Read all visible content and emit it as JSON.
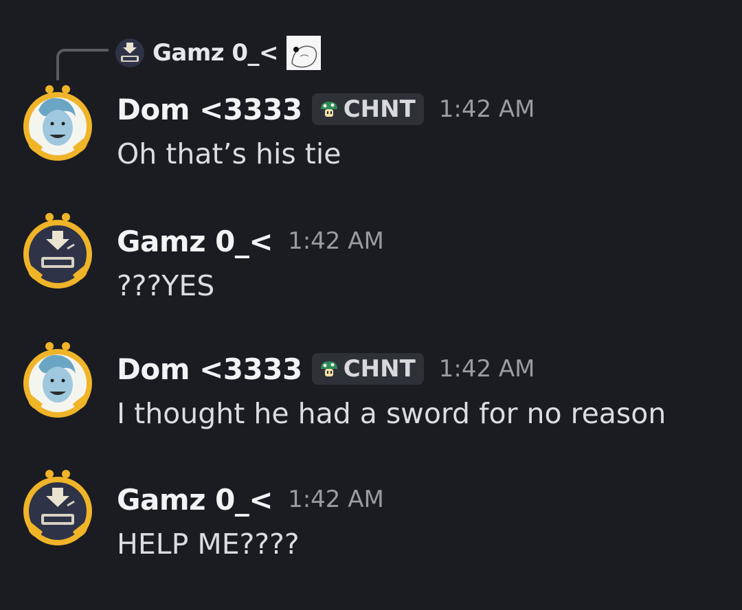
{
  "colors": {
    "background": "#1b1c21",
    "author": "#f2f3f5",
    "message_text": "#dcdde0",
    "timestamp": "#9a9ca3",
    "tag_background": "#2f3138",
    "avatar_ring": "#f0b429"
  },
  "reply": {
    "author": "Gamz 0_<",
    "avatar_icon": "gamz-avatar-icon",
    "attachment_icon": "image-thumbnail-icon"
  },
  "messages": [
    {
      "author": "Dom <3333",
      "tag": "CHNT",
      "tag_icon": "mushroom-icon",
      "time": "1:42 AM",
      "text": "Oh that’s his tie",
      "avatar_icon": "dom-avatar-icon"
    },
    {
      "author": "Gamz 0_<",
      "time": "1:42 AM",
      "text": "???YES",
      "avatar_icon": "gamz-avatar-icon"
    },
    {
      "author": "Dom <3333",
      "tag": "CHNT",
      "tag_icon": "mushroom-icon",
      "time": "1:42 AM",
      "text": "I thought he had a sword for no reason",
      "avatar_icon": "dom-avatar-icon"
    },
    {
      "author": "Gamz 0_<",
      "time": "1:42 AM",
      "text": "HELP ME????",
      "avatar_icon": "gamz-avatar-icon"
    }
  ]
}
